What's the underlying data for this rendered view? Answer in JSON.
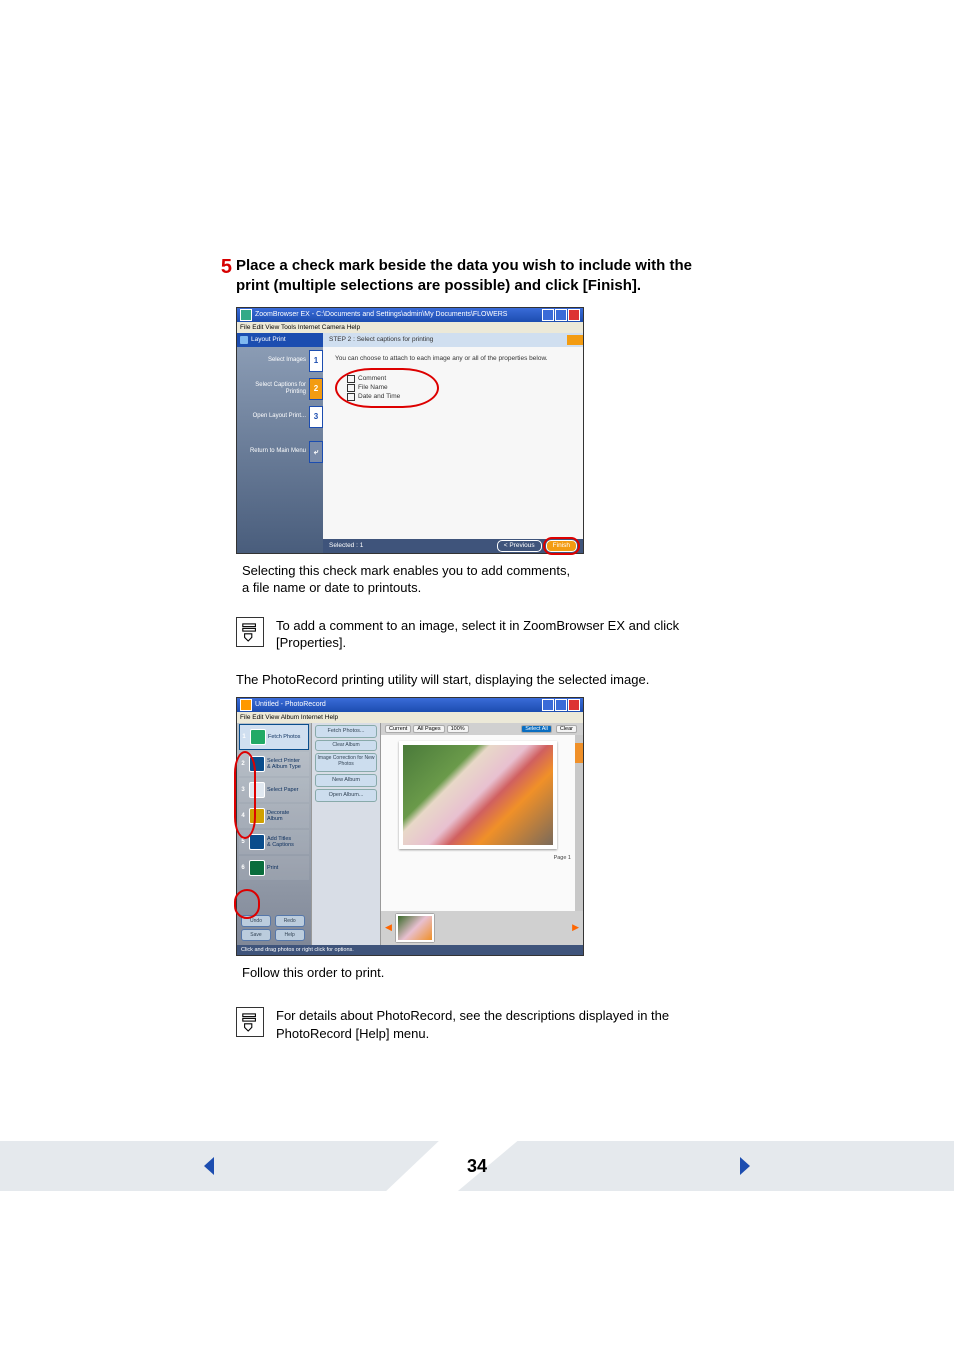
{
  "step_number": "5",
  "step_text_line1": "Place a check mark beside the data you wish to include with the",
  "step_text_line2": "print (multiple selections are possible) and click [Finish].",
  "shot1": {
    "title": "ZoomBrowser EX - C:\\Documents and Settings\\admin\\My Documents\\FLOWERS",
    "menu": "File  Edit  View  Tools  Internet  Camera  Help",
    "header": "Layout Print",
    "side": {
      "i1": "Select Images",
      "i2a": "Select Captions for",
      "i2b": "Printing",
      "i3": "Open Layout Print...",
      "ret": "Return to Main Menu"
    },
    "step_hdr": "STEP 2 : Select captions for printing",
    "instr": "You can choose to attach to each image any or all of the properties below.",
    "opts": {
      "c": "Comment",
      "f": "File Name",
      "d": "Date and Time"
    },
    "foot": {
      "sel": "Selected : 1",
      "prev": "< Previous",
      "fin": "Finish"
    }
  },
  "caption1a": "Selecting this check mark enables you to add comments,",
  "caption1b": "a file name or date to printouts.",
  "note1a": "To add a comment to an image, select it in ZoomBrowser EX and click",
  "note1b": "[Properties].",
  "para1": "The PhotoRecord printing utility will start, displaying the selected image.",
  "shot2": {
    "title": "Untitled - PhotoRecord",
    "menu": "File  Edit  View  Album  Internet  Help",
    "steps": {
      "s1": "Fetch Photos",
      "s2a": "Select Printer",
      "s2b": "& Album Type",
      "s3": "Select Paper",
      "s4a": "Decorate",
      "s4b": "Album",
      "s5a": "Add Titles",
      "s5b": "& Captions",
      "s6": "Print"
    },
    "bot": {
      "undo": "Undo",
      "redo": "Redo",
      "save": "Save",
      "help": "Help"
    },
    "mid": {
      "b1": "Fetch Photos...",
      "b2": "Clear Album",
      "b3": "Image Correction for New Photos",
      "b4": "New Album",
      "b5": "Open Album..."
    },
    "tb": {
      "c1": "Current",
      "c2": "All Pages",
      "zoom": "100%",
      "sa": "Select All",
      "clr": "Clear"
    },
    "page": "Page 1",
    "status": "Click and drag photos or right click for options."
  },
  "caption2": "Follow this order to print.",
  "note2a": "For details about PhotoRecord, see the descriptions displayed in the",
  "note2b": "PhotoRecord [Help] menu.",
  "page_number": "34"
}
